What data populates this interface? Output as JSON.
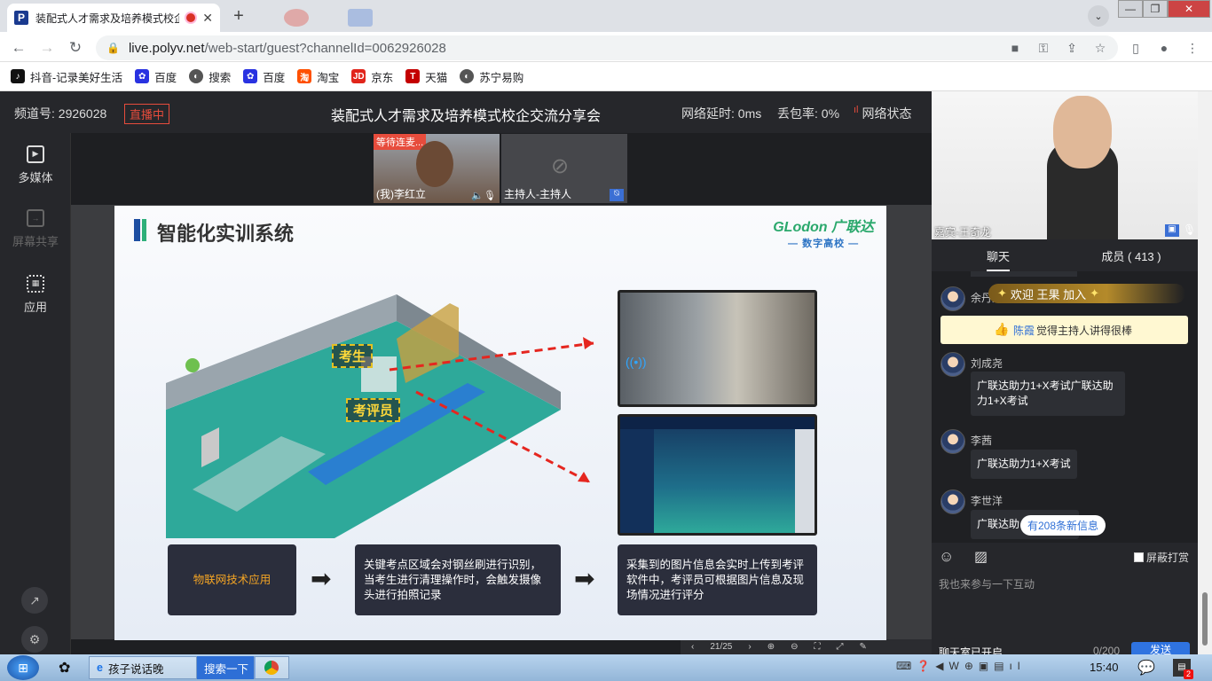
{
  "browser": {
    "tab_title": "装配式人才需求及培养模式校企",
    "url_host": "live.polyv.net",
    "url_path": "/web-start/guest?channelId=0062926028",
    "bookmarks": [
      "抖音-记录美好生活",
      "百度",
      "搜索",
      "百度",
      "淘宝",
      "京东",
      "天猫",
      "苏宁易购"
    ]
  },
  "header": {
    "channel": "频道号: 2926028",
    "live_badge": "直播中",
    "title": "装配式人才需求及培养模式校企交流分享会",
    "latency": "网络延时: 0ms",
    "packet_loss": "丢包率: 0%",
    "net_status": "网络状态"
  },
  "sidebar": {
    "media": "多媒体",
    "screen_share": "屏幕共享",
    "apps": "应用"
  },
  "videos": {
    "waiting": "等待连麦...",
    "me": "(我)李红立",
    "host": "主持人-主持人"
  },
  "slide": {
    "title": "智能化实训系统",
    "logo": "GLodon 广联达",
    "logo_sub": "— 数字高校 —",
    "tag_student": "考生",
    "tag_examiner": "考评员",
    "flow1": "物联网技术应用",
    "flow2": "关键考点区域会对钢丝刷进行识别，当考生进行清理操作时，会触发摄像头进行拍照记录",
    "flow3": "采集到的图片信息会实时上传到考评软件中，考评员可根据图片信息及现场情况进行评分"
  },
  "slide_toolbar": {
    "page": "21/25"
  },
  "right": {
    "guest_label": "嘉宾-王奇龙",
    "tab_chat": "聊天",
    "tab_members": "成员 ( 413 )",
    "welcome": "欢迎  王果  加入",
    "welcome_user": "余丹丹",
    "like_name": "陈霞",
    "like_text": "觉得主持人讲得很棒",
    "messages": [
      {
        "user": "刘成尧",
        "text": "广联达助力1+X考试广联达助力1+X考试"
      },
      {
        "user": "李茜",
        "text": "广联达助力1+X考试"
      },
      {
        "user": "李世洋",
        "text": "广联达助"
      }
    ],
    "new_messages": "有208条新信息",
    "block_gift": "屏蔽打赏",
    "input_placeholder": "我也来参与一下互动",
    "chat_on": "聊天室已开启",
    "char_count": "0/200",
    "send": "发送"
  },
  "taskbar": {
    "ie_label": "孩子说话晚",
    "search_btn": "搜索一下",
    "time": "15:40",
    "badge": "2"
  }
}
